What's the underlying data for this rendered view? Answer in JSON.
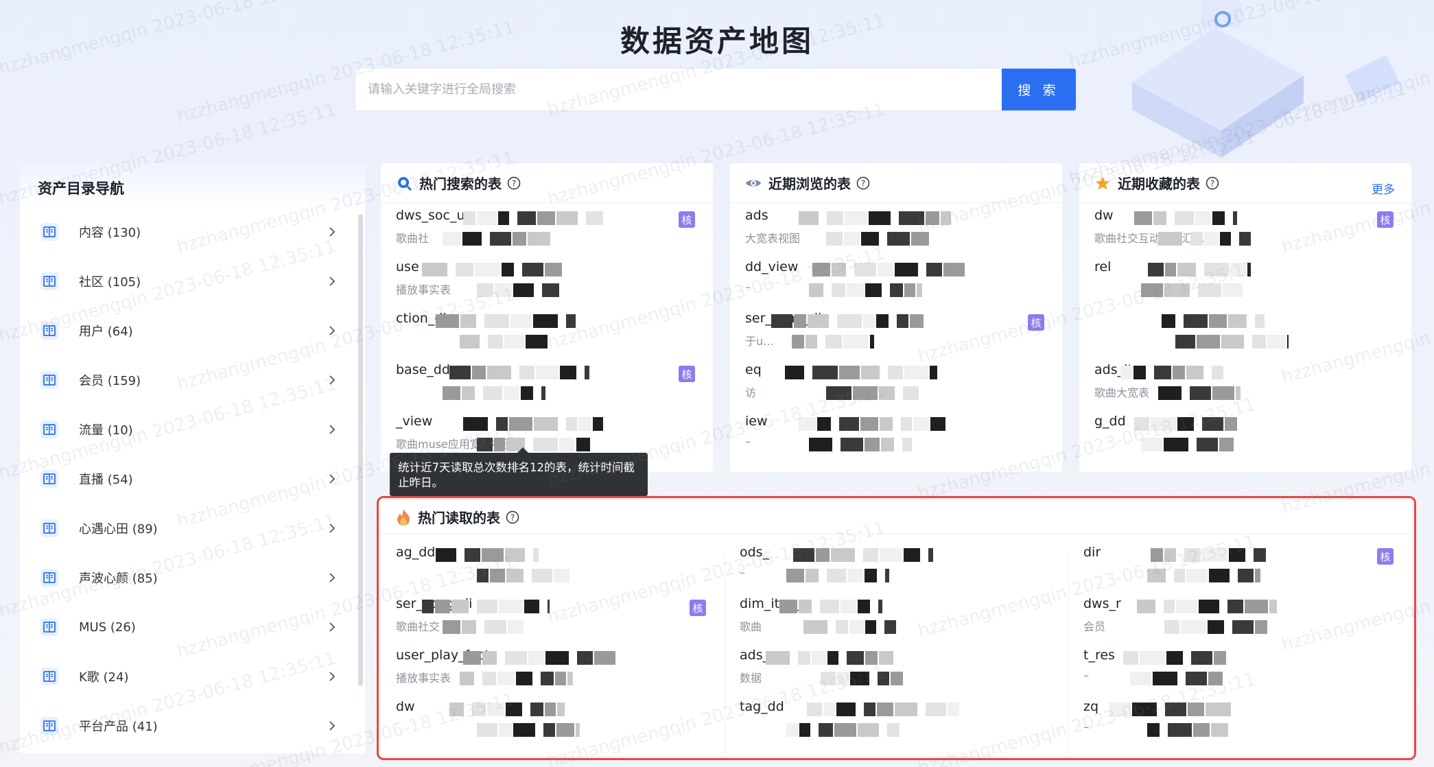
{
  "page": {
    "title": "数据资产地图"
  },
  "search": {
    "placeholder": "请输入关键字进行全局搜索",
    "button_label": "搜 索"
  },
  "watermark": {
    "text": "hzzhangmengqin 2023-06-18 12:35:11"
  },
  "sidebar": {
    "title": "资产目录导航",
    "items": [
      {
        "label": "内容 (130)"
      },
      {
        "label": "社区 (105)"
      },
      {
        "label": "用户 (64)"
      },
      {
        "label": "会员 (159)"
      },
      {
        "label": "流量 (10)"
      },
      {
        "label": "直播 (54)"
      },
      {
        "label": "心遇心田 (89)"
      },
      {
        "label": "声波心颜 (85)"
      },
      {
        "label": "MUS (26)"
      },
      {
        "label": "K歌 (24)"
      },
      {
        "label": "平台产品 (41)"
      }
    ]
  },
  "cards": {
    "hot_search": {
      "title": "热门搜索的表",
      "icon": "search-icon",
      "rows": [
        {
          "name": "dws_soc_us",
          "desc": "歌曲社",
          "badge": "核"
        },
        {
          "name": "use",
          "desc": "播放事实表",
          "badge": ""
        },
        {
          "name": "ction_di",
          "desc": "",
          "badge": ""
        },
        {
          "name": "base_dd",
          "desc": "",
          "badge": "核"
        },
        {
          "name": "_view",
          "desc": "歌曲muse应用宽表视图",
          "badge": ""
        }
      ]
    },
    "recent_view": {
      "title": "近期浏览的表",
      "icon": "eye-icon",
      "rows": [
        {
          "name": "ads",
          "desc": "大宽表视图",
          "badge": ""
        },
        {
          "name": "dd_view",
          "desc": "–",
          "badge": ""
        },
        {
          "name": "ser_song_di",
          "desc": "于u...",
          "badge": "核"
        },
        {
          "name": "eq",
          "desc": "访",
          "badge": ""
        },
        {
          "name": "iew",
          "desc": "–",
          "badge": ""
        }
      ]
    },
    "recent_fav": {
      "title": "近期收藏的表",
      "icon": "star-icon",
      "more": "更多",
      "rows": [
        {
          "name": "dw",
          "desc": "歌曲社交互动轻度汇总",
          "badge": "核"
        },
        {
          "name": "rel",
          "desc": "",
          "badge": ""
        },
        {
          "name": "",
          "desc": "",
          "badge": ""
        },
        {
          "name": "ads_itm",
          "desc": "歌曲大宽表",
          "badge": ""
        },
        {
          "name": "g_dd",
          "desc": "",
          "badge": ""
        }
      ]
    }
  },
  "tooltip": {
    "text": "统计近7天读取总次数排名12的表，统计时间截止昨日。"
  },
  "hot_read": {
    "title": "热门读取的表",
    "icon": "fire-icon",
    "columns": [
      [
        {
          "name": "ag_dd",
          "desc": "",
          "badge": ""
        },
        {
          "name": "ser_song_di",
          "desc": "歌曲社交",
          "badge": "核"
        },
        {
          "name": "user_play_fact",
          "desc": "播放事实表",
          "badge": ""
        },
        {
          "name": "dw",
          "desc": "",
          "badge": ""
        }
      ],
      [
        {
          "name": "ods_",
          "desc": "–",
          "badge": ""
        },
        {
          "name": "dim_itm_p",
          "desc": "歌曲",
          "badge": ""
        },
        {
          "name": "ads_",
          "desc": "数据",
          "badge": ""
        },
        {
          "name": "tag_dd",
          "desc": "",
          "badge": ""
        }
      ],
      [
        {
          "name": "dir",
          "desc": "",
          "badge": "核"
        },
        {
          "name": "dws_r",
          "desc": "会员",
          "badge": ""
        },
        {
          "name": "t_res",
          "desc": "–",
          "badge": ""
        },
        {
          "name": "zq",
          "desc": "–",
          "badge": ""
        }
      ]
    ]
  }
}
